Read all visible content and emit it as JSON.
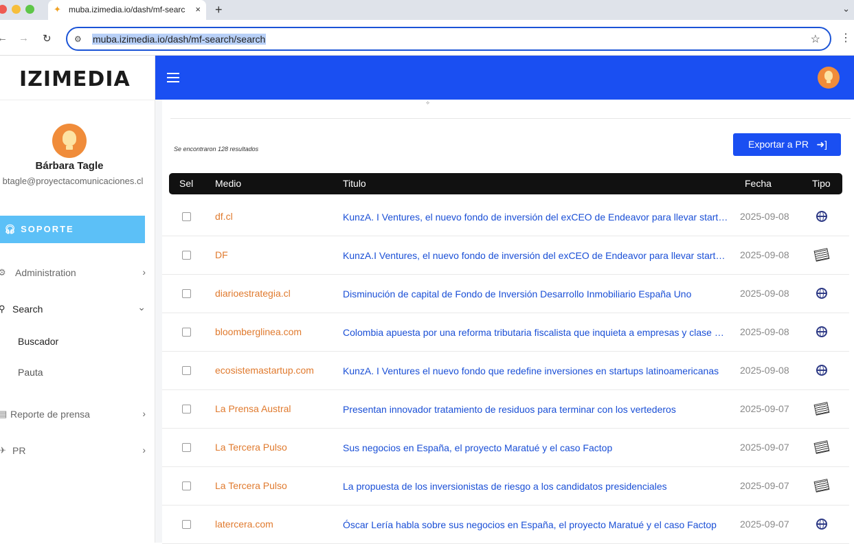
{
  "browser": {
    "tab_title": "muba.izimedia.io/dash/mf-search",
    "tab_close": "×",
    "new_tab": "+",
    "url": "muba.izimedia.io/dash/mf-search/search"
  },
  "sidebar": {
    "logo": "IZIMEDIA",
    "user_name": "Bárbara Tagle",
    "user_email": "btagle@proyectacomunicaciones.cl",
    "support_label": "SOPORTE",
    "items": [
      {
        "label": "Administration",
        "icon": "gears-icon",
        "expanded": false
      },
      {
        "label": "Search",
        "icon": "search-icon",
        "expanded": true
      },
      {
        "label": "Reporte de prensa",
        "icon": "clipboard-icon",
        "expanded": false
      },
      {
        "label": "PR",
        "icon": "send-icon",
        "expanded": false
      }
    ],
    "search_sub": [
      "Buscador",
      "Pauta"
    ]
  },
  "header": {
    "accent": "#1a4ff2"
  },
  "main": {
    "results_text": "Se encontraron 128 resultados",
    "export_label": "Exportar a PR",
    "columns": [
      "Sel",
      "Medio",
      "Titulo",
      "Fecha",
      "Tipo"
    ],
    "rows": [
      {
        "medio": "df.cl",
        "titulo": "KunzA. I Ventures, el nuevo fondo de inversión del exCEO de Endeavor para llevar startups",
        "fecha": "2025-09-08",
        "tipo": "web"
      },
      {
        "medio": "DF",
        "titulo": "KunzA.I Ventures, el nuevo fondo de inversión del exCEO de Endeavor para llevar startups",
        "fecha": "2025-09-08",
        "tipo": "print"
      },
      {
        "medio": "diarioestrategia.cl",
        "titulo": "Disminución de capital de Fondo de Inversión Desarrollo Inmobiliario España Uno",
        "fecha": "2025-09-08",
        "tipo": "web"
      },
      {
        "medio": "bloomberglinea.com",
        "titulo": "Colombia apuesta por una reforma tributaria fiscalista que inquieta a empresas y clase media",
        "fecha": "2025-09-08",
        "tipo": "web"
      },
      {
        "medio": "ecosistemastartup.com",
        "titulo": "KunzA. I Ventures el nuevo fondo que redefine inversiones en startups latinoamericanas",
        "fecha": "2025-09-08",
        "tipo": "web"
      },
      {
        "medio": "La Prensa Austral",
        "titulo": "Presentan innovador tratamiento de residuos para terminar con los vertederos",
        "fecha": "2025-09-07",
        "tipo": "print"
      },
      {
        "medio": "La Tercera Pulso",
        "titulo": "Sus negocios en España, el proyecto Maratué y el caso Factop",
        "fecha": "2025-09-07",
        "tipo": "print"
      },
      {
        "medio": "La Tercera Pulso",
        "titulo": "La propuesta de los inversionistas de riesgo a los candidatos presidenciales",
        "fecha": "2025-09-07",
        "tipo": "print"
      },
      {
        "medio": "latercera.com",
        "titulo": "Óscar Lería habla sobre sus negocios en España, el proyecto Maratué y el caso Factop",
        "fecha": "2025-09-07",
        "tipo": "web"
      }
    ]
  }
}
